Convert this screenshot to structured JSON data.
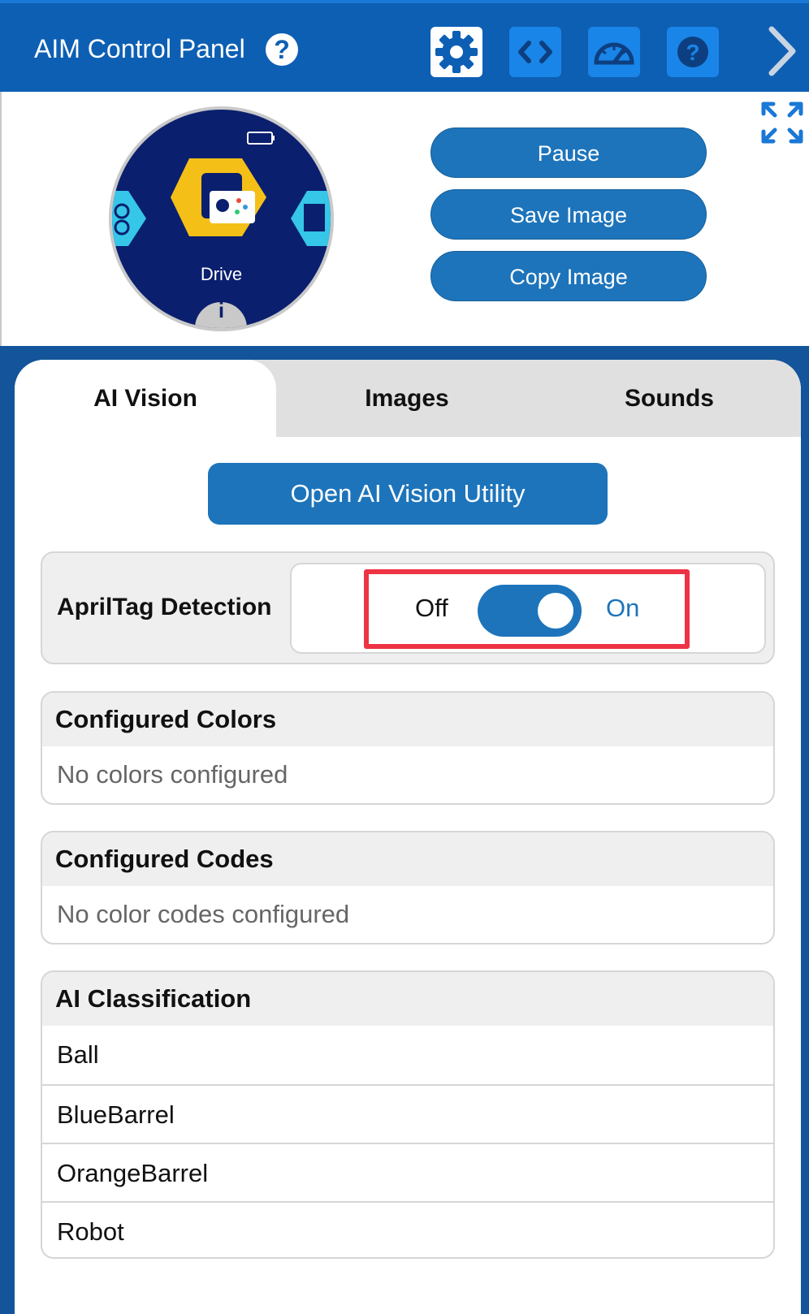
{
  "header": {
    "title": "AIM Control Panel",
    "help_icon": "question-circle-icon",
    "buttons": [
      {
        "icon": "gear-icon",
        "active": true
      },
      {
        "icon": "code-icon",
        "active": false
      },
      {
        "icon": "gauge-icon",
        "active": false
      },
      {
        "icon": "question-icon",
        "active": false
      }
    ],
    "next_icon": "chevron-right-icon"
  },
  "robot_screen": {
    "label": "Drive",
    "info_glyph": "i"
  },
  "actions": {
    "pause": "Pause",
    "save_image": "Save Image",
    "copy_image": "Copy Image"
  },
  "tabs": [
    "AI Vision",
    "Images",
    "Sounds"
  ],
  "ai_vision": {
    "open_button": "Open AI Vision Utility",
    "apriltag": {
      "label": "AprilTag Detection",
      "off": "Off",
      "on": "On",
      "state": "on"
    },
    "colors": {
      "title": "Configured Colors",
      "empty": "No colors configured"
    },
    "codes": {
      "title": "Configured Codes",
      "empty": "No color codes configured"
    },
    "classification": {
      "title": "AI Classification",
      "items": [
        "Ball",
        "BlueBarrel",
        "OrangeBarrel",
        "Robot"
      ]
    }
  },
  "colors": {
    "header_bg": "#0d5fb3",
    "button_bg": "#1d74bb",
    "highlight": "#ee3344"
  }
}
